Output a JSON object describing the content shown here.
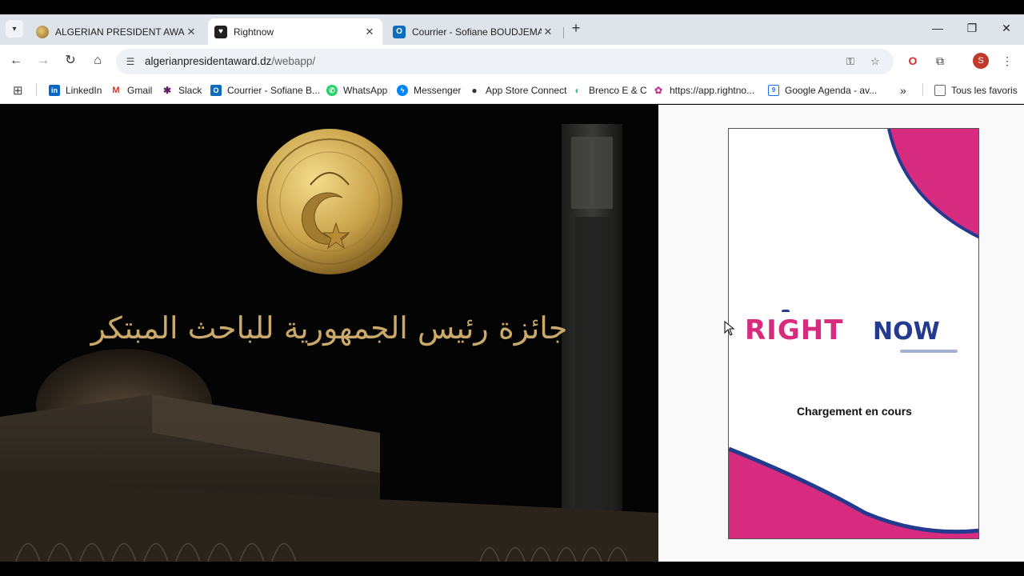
{
  "browser": {
    "tabs": [
      {
        "title": "ALGERIAN PRESIDENT AWARD",
        "active": false
      },
      {
        "title": "Rightnow",
        "active": true
      },
      {
        "title": "Courrier - Sofiane BOUDJEMA -",
        "active": false
      }
    ],
    "url_host": "algerianpresidentaward.dz",
    "url_path": "/webapp/",
    "profile_initial": "S",
    "bookmarks": [
      {
        "label": "LinkedIn",
        "icon": "linkedin-icon",
        "color": "#0a66c2"
      },
      {
        "label": "Gmail",
        "icon": "gmail-icon",
        "color": "#d93025"
      },
      {
        "label": "Slack",
        "icon": "slack-icon",
        "color": "#611f69"
      },
      {
        "label": "Courrier - Sofiane B...",
        "icon": "outlook-icon",
        "color": "#0f6cbd"
      },
      {
        "label": "WhatsApp",
        "icon": "whatsapp-icon",
        "color": "#25d366"
      },
      {
        "label": "Messenger",
        "icon": "messenger-icon",
        "color": "#0084ff"
      },
      {
        "label": "App Store Connect",
        "icon": "apple-icon",
        "color": "#333333"
      },
      {
        "label": "Brenco E & C",
        "icon": "brenco-icon",
        "color": "#2ecc71"
      },
      {
        "label": "https://app.rightno...",
        "icon": "rightnow-icon",
        "color": "#c0398a"
      },
      {
        "label": "Google Agenda - av...",
        "icon": "calendar-icon",
        "color": "#1a73e8"
      }
    ],
    "all_bookmarks_label": "Tous les favoris"
  },
  "page": {
    "hero_text": "جائزة رئيس الجمهورية للباحث المبتكر",
    "logo_right": "RIGHT",
    "logo_now": "NOW",
    "loading_text": "Chargement en cours",
    "colors": {
      "pink": "#d72b7f",
      "navy": "#233a8e",
      "gold": "#caa96a"
    }
  }
}
